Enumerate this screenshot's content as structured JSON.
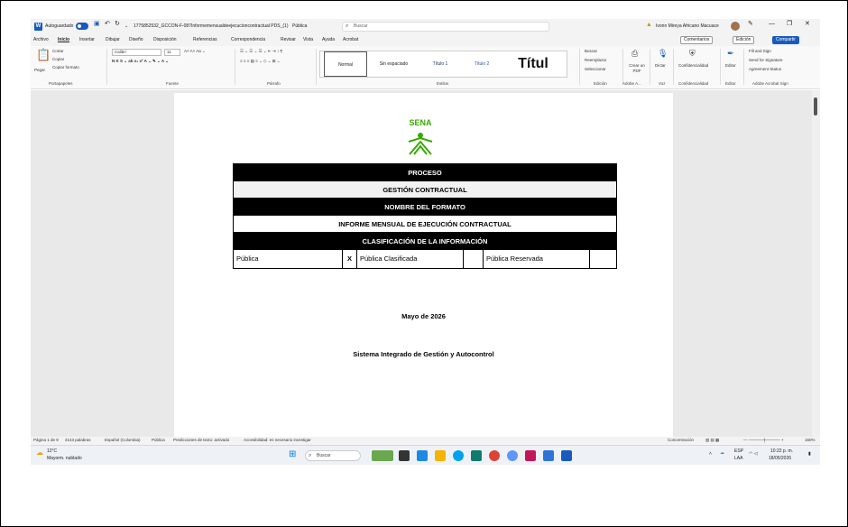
{
  "titlebar": {
    "autosave_label": "Autoguardado",
    "filename": "1775852532_GCCON-F-087Informemensualdeejecucioncontractual PDS_(1)",
    "sensitivity": "Pública",
    "search_placeholder": "Buscar",
    "user_name": "Ivonn Mireya Africano Macuace"
  },
  "menu": {
    "items": [
      "Archivo",
      "Inicio",
      "Insertar",
      "Dibujar",
      "Diseño",
      "Disposición",
      "Referencias",
      "Correspondencia",
      "Revisar",
      "Vista",
      "Ayuda",
      "Acrobat"
    ],
    "comments": "Comentarios",
    "editing": "Edición",
    "share": "Compartir"
  },
  "ribbon": {
    "paste": "Pegar",
    "cut": "Cortar",
    "copy": "Copiar",
    "format_painter": "Copiar formato",
    "font_name": "Calibri",
    "font_size": "11",
    "styles": [
      "Normal",
      "Sin espaciado",
      "Título 1",
      "Título 2",
      "Títul"
    ],
    "find": "Buscar",
    "replace": "Reemplazar",
    "select": "Seleccionar",
    "create_pdf": "Crear un PDF",
    "dictate": "Dictar",
    "confidentiality": "Confidencialidad",
    "editor": "Editor",
    "fill_sign": "Fill and Sign",
    "send_signature": "Send for Signature",
    "agreement_status": "Agreement Status",
    "group_labels": [
      "Portapapeles",
      "Fuente",
      "Párrafo",
      "Estilos",
      "Edición",
      "Adobe A...",
      "Voz",
      "Confidencialidad",
      "Editor",
      "Adobe Acrobat Sign"
    ]
  },
  "document": {
    "logo_text": "SENA",
    "rows": {
      "proceso": "PROCESO",
      "gestion": "GESTIÓN CONTRACTUAL",
      "nombre": "NOMBRE DEL FORMATO",
      "informe": "INFORME MENSUAL DE EJECUCIÓN CONTRACTUAL",
      "clasificacion": "CLASIFICACIÓN DE LA INFORMACIÓN"
    },
    "classification": {
      "publica": "Pública",
      "mark": "X",
      "clasificada": "Pública Clasificada",
      "reservada": "Pública Reservada"
    },
    "date": "Mayo de 2026",
    "system": "Sistema Integrado de Gestión y Autocontrol"
  },
  "statusbar": {
    "page": "Página 1 de 9",
    "words": "2143 palabras",
    "language": "Español (Colombia)",
    "sensitivity": "Pública",
    "predictions": "Predicciones de texto: activado",
    "accessibility": "Accesibilidad: es necesario investigar",
    "focus": "Concentración",
    "zoom": "150%"
  },
  "taskbar": {
    "temperature": "12°C",
    "weather": "Mayorm. nublado",
    "search": "Buscar",
    "lang_top": "ESP",
    "lang_bottom": "LAA",
    "time": "10:22 p. m.",
    "date": "18/05/2026"
  },
  "colors": {
    "word_blue": "#185abd",
    "sena_green": "#39a900",
    "table_dark": "#000000"
  }
}
